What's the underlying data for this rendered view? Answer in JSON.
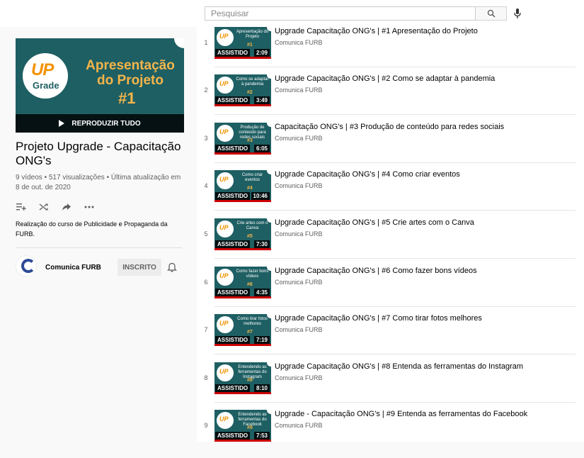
{
  "header": {
    "search_placeholder": "Pesquisar",
    "search_icon": "search-icon",
    "mic_icon": "mic-icon"
  },
  "playlist": {
    "thumb_title": "Apresentação do Projeto",
    "thumb_number": "#1",
    "thumb_logo_top": "UP",
    "thumb_logo_bottom": "Grade",
    "play_all_label": "REPRODUZIR TUDO",
    "title": "Projeto Upgrade - Capacitação ONG's",
    "stats": "9 vídeos • 517 visualizações • Última atualização em 8 de out. de 2020",
    "description": "Realização do curso de Publicidade e Propaganda da FURB.",
    "channel_name": "Comunica FURB",
    "subscribe_label": "INSCRITO",
    "actions": [
      "add-to-queue-icon",
      "shuffle-icon",
      "share-icon",
      "more-icon"
    ]
  },
  "videos": [
    {
      "index": "1",
      "title": "Upgrade Capacitação ONG's | #1 Apresentação do Projeto",
      "channel": "Comunica FURB",
      "badge": "ASSISTIDO",
      "duration": "2:09",
      "thumb_text": "Apresentação do Projeto",
      "thumb_num": "#1"
    },
    {
      "index": "2",
      "title": "Upgrade Capacitação ONG's | #2 Como se adaptar à pandemia",
      "channel": "Comunica FURB",
      "badge": "ASSISTIDO",
      "duration": "3:49",
      "thumb_text": "Como se adaptar à pandemia",
      "thumb_num": "#2"
    },
    {
      "index": "3",
      "title": "Capacitação ONG's | #3 Produção de conteúdo para redes sociais",
      "channel": "Comunica FURB",
      "badge": "ASSISTIDO",
      "duration": "6:05",
      "thumb_text": "Produção de conteúdo para redes sociais",
      "thumb_num": "#3"
    },
    {
      "index": "4",
      "title": "Upgrade Capacitação ONG's | #4 Como criar eventos",
      "channel": "Comunica FURB",
      "badge": "ASSISTIDO",
      "duration": "10:46",
      "thumb_text": "Como criar eventos",
      "thumb_num": "#4"
    },
    {
      "index": "5",
      "title": "Upgrade Capacitação ONG's | #5 Crie artes com o Canva",
      "channel": "Comunica FURB",
      "badge": "ASSISTIDO",
      "duration": "7:30",
      "thumb_text": "Crie artes com o Canva",
      "thumb_num": "#5"
    },
    {
      "index": "6",
      "title": "Upgrade Capacitação ONG's | #6 Como fazer bons vídeos",
      "channel": "Comunica FURB",
      "badge": "ASSISTIDO",
      "duration": "4:35",
      "thumb_text": "Como fazer bons vídeos",
      "thumb_num": "#6"
    },
    {
      "index": "7",
      "title": "Upgrade Capacitação ONG's | #7 Como tirar fotos melhores",
      "channel": "Comunica FURB",
      "badge": "ASSISTIDO",
      "duration": "7:19",
      "thumb_text": "Como tirar fotos melhores",
      "thumb_num": "#7"
    },
    {
      "index": "8",
      "title": "Upgrade Capacitação ONG's | #8 Entenda as ferramentas do Instagram",
      "channel": "Comunica FURB",
      "badge": "ASSISTIDO",
      "duration": "8:10",
      "thumb_text": "Entendendo as ferramentas do Instagram",
      "thumb_num": "#8"
    },
    {
      "index": "9",
      "title": "Upgrade - Capacitação ONG's | #9 Entenda as ferramentas do Facebook",
      "channel": "Comunica FURB",
      "badge": "ASSISTIDO",
      "duration": "7:53",
      "thumb_text": "Entendendo as ferramentas do Facebook",
      "thumb_num": "#9"
    }
  ],
  "colors": {
    "accent_red": "#cc0000",
    "thumb_teal": "#1e5f63",
    "brand_orange": "#f39200"
  }
}
